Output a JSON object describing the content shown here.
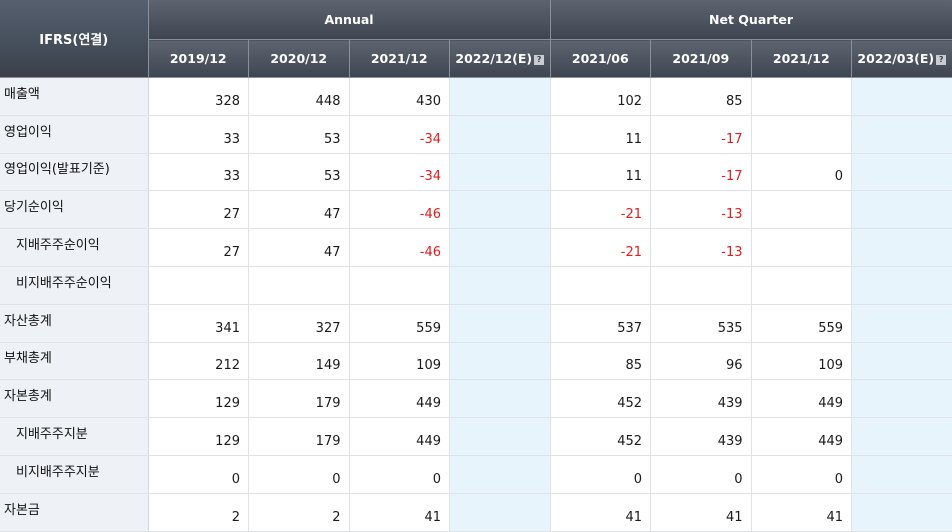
{
  "header": {
    "corner_label": "IFRS(연결)",
    "annual_label": "Annual",
    "quarter_label": "Net Quarter",
    "annual_columns": [
      "2019/12",
      "2020/12",
      "2021/12",
      "2022/12(E)"
    ],
    "quarter_columns": [
      "2021/06",
      "2021/09",
      "2021/12",
      "2022/03(E)"
    ],
    "help_icon": "question-mark-icon"
  },
  "rows": [
    {
      "label": "매출액",
      "sub": false,
      "annual": [
        "328",
        "448",
        "430",
        ""
      ],
      "quarter": [
        "102",
        "85",
        "",
        ""
      ]
    },
    {
      "label": "영업이익",
      "sub": false,
      "annual": [
        "33",
        "53",
        "-34",
        ""
      ],
      "quarter": [
        "11",
        "-17",
        "",
        ""
      ]
    },
    {
      "label": "영업이익(발표기준)",
      "sub": false,
      "annual": [
        "33",
        "53",
        "-34",
        ""
      ],
      "quarter": [
        "11",
        "-17",
        "0",
        ""
      ]
    },
    {
      "label": "당기순이익",
      "sub": false,
      "annual": [
        "27",
        "47",
        "-46",
        ""
      ],
      "quarter": [
        "-21",
        "-13",
        "",
        ""
      ]
    },
    {
      "label": "지배주주순이익",
      "sub": true,
      "annual": [
        "27",
        "47",
        "-46",
        ""
      ],
      "quarter": [
        "-21",
        "-13",
        "",
        ""
      ]
    },
    {
      "label": "비지배주주순이익",
      "sub": true,
      "annual": [
        "",
        "",
        "",
        ""
      ],
      "quarter": [
        "",
        "",
        "",
        ""
      ]
    },
    {
      "label": "자산총계",
      "sub": false,
      "annual": [
        "341",
        "327",
        "559",
        ""
      ],
      "quarter": [
        "537",
        "535",
        "559",
        ""
      ]
    },
    {
      "label": "부채총계",
      "sub": false,
      "annual": [
        "212",
        "149",
        "109",
        ""
      ],
      "quarter": [
        "85",
        "96",
        "109",
        ""
      ]
    },
    {
      "label": "자본총계",
      "sub": false,
      "annual": [
        "129",
        "179",
        "449",
        ""
      ],
      "quarter": [
        "452",
        "439",
        "449",
        ""
      ]
    },
    {
      "label": "지배주주지분",
      "sub": true,
      "annual": [
        "129",
        "179",
        "449",
        ""
      ],
      "quarter": [
        "452",
        "439",
        "449",
        ""
      ]
    },
    {
      "label": "비지배주주지분",
      "sub": true,
      "annual": [
        "0",
        "0",
        "0",
        ""
      ],
      "quarter": [
        "0",
        "0",
        "0",
        ""
      ]
    },
    {
      "label": "자본금",
      "sub": false,
      "annual": [
        "2",
        "2",
        "41",
        ""
      ],
      "quarter": [
        "41",
        "41",
        "41",
        ""
      ]
    }
  ],
  "colors": {
    "header_bg": "#4a505b",
    "label_bg": "#eef1f5",
    "estimate_bg": "#e8f4fb",
    "negative_text": "#e01e1e"
  }
}
